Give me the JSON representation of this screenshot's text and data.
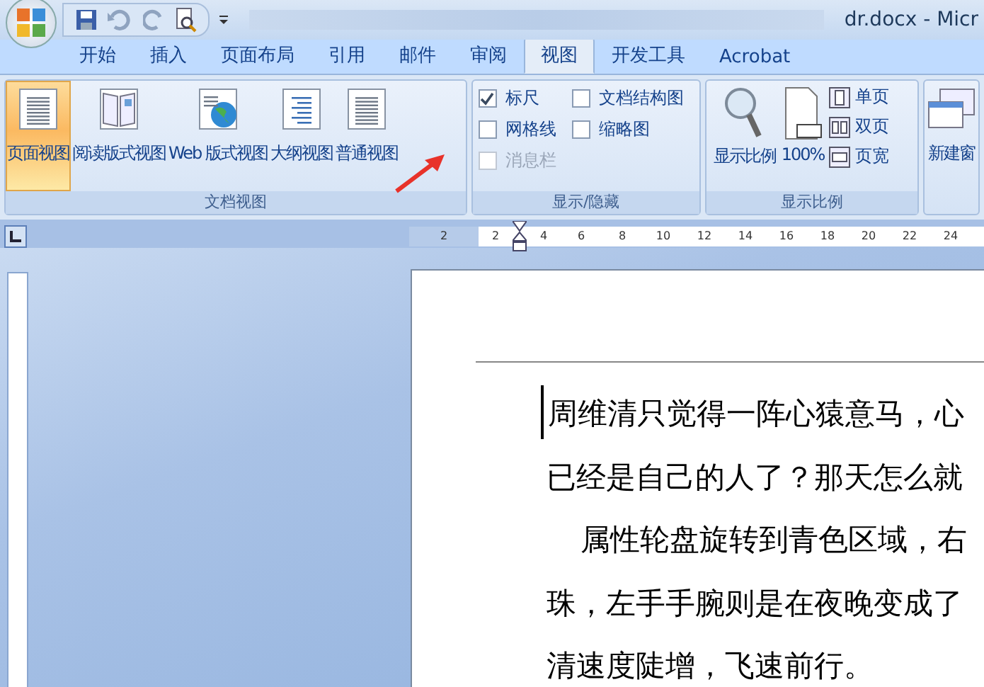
{
  "window": {
    "title": "dr.docx - Micr"
  },
  "tabs": [
    {
      "label": "开始",
      "selected": false
    },
    {
      "label": "插入",
      "selected": false
    },
    {
      "label": "页面布局",
      "selected": false
    },
    {
      "label": "引用",
      "selected": false
    },
    {
      "label": "邮件",
      "selected": false
    },
    {
      "label": "审阅",
      "selected": false
    },
    {
      "label": "视图",
      "selected": true
    },
    {
      "label": "开发工具",
      "selected": false
    },
    {
      "label": "Acrobat",
      "selected": false
    }
  ],
  "document_views": {
    "label": "文档视图",
    "buttons": [
      {
        "label": "页面视图",
        "selected": true,
        "kind": "page"
      },
      {
        "label": "阅读版式视图",
        "selected": false,
        "kind": "book"
      },
      {
        "label": "Web 版式视图",
        "selected": false,
        "kind": "web"
      },
      {
        "label": "大纲视图",
        "selected": false,
        "kind": "outline"
      },
      {
        "label": "普通视图",
        "selected": false,
        "kind": "draft"
      }
    ]
  },
  "show_hide": {
    "label": "显示/隐藏",
    "items": [
      {
        "label": "标尺",
        "checked": true,
        "disabled": false
      },
      {
        "label": "文档结构图",
        "checked": false,
        "disabled": false
      },
      {
        "label": "网格线",
        "checked": false,
        "disabled": false
      },
      {
        "label": "缩略图",
        "checked": false,
        "disabled": false
      },
      {
        "label": "消息栏",
        "checked": false,
        "disabled": true
      }
    ]
  },
  "zoom": {
    "label": "显示比例",
    "buttons": [
      {
        "label": "显示比例",
        "kind": "magnifier"
      },
      {
        "label": "100%",
        "kind": "page100"
      }
    ],
    "page_buttons": [
      {
        "label": "单页",
        "kind": "one"
      },
      {
        "label": "双页",
        "kind": "two"
      },
      {
        "label": "页宽",
        "kind": "width"
      }
    ]
  },
  "window_group": {
    "buttons": [
      {
        "label": "新建窗"
      }
    ]
  },
  "ruler": {
    "ticks": [
      "2",
      "2",
      "4",
      "6",
      "8",
      "10",
      "12",
      "14",
      "16",
      "18",
      "20",
      "22",
      "24"
    ]
  },
  "document": {
    "lines": [
      {
        "text": "周维清只觉得一阵心猿意马，心",
        "indent": false
      },
      {
        "text": "已经是自己的人了？那天怎么就",
        "indent": false
      },
      {
        "text": "属性轮盘旋转到青色区域，右",
        "indent": true
      },
      {
        "text": "珠，左手手腕则是在夜晚变成了",
        "indent": false
      },
      {
        "text": "清速度陡增，飞速前行。",
        "indent": false
      }
    ]
  }
}
